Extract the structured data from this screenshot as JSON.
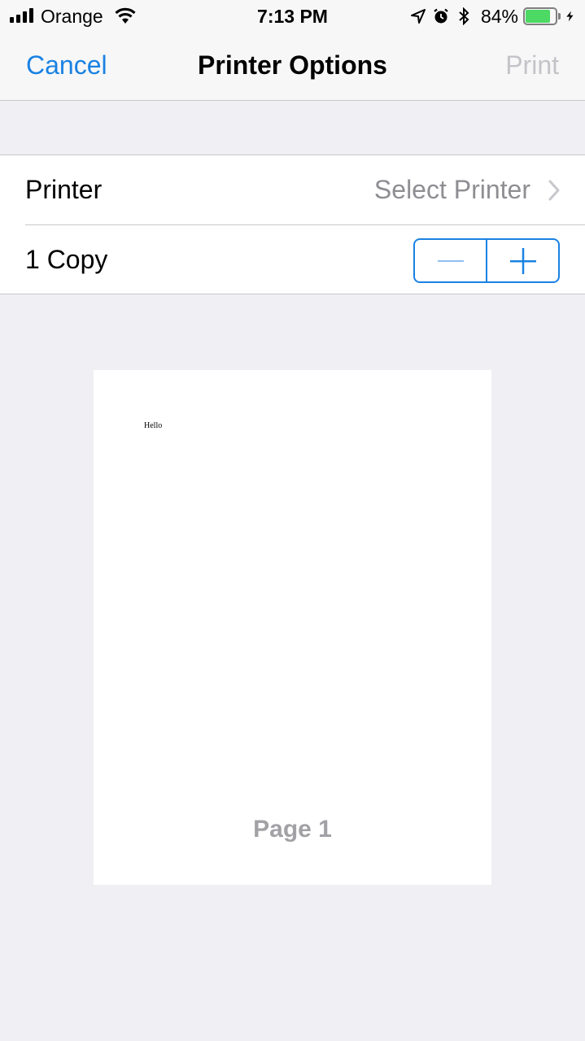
{
  "status_bar": {
    "carrier": "Orange",
    "time": "7:13 PM",
    "battery_percent": "84%",
    "battery_level": 0.84,
    "icons": [
      "signal-icon",
      "wifi-icon",
      "location-arrow-icon",
      "alarm-icon",
      "bluetooth-icon",
      "battery-icon",
      "charging-bolt-icon"
    ]
  },
  "nav": {
    "cancel_label": "Cancel",
    "title": "Printer Options",
    "print_label": "Print"
  },
  "options": {
    "printer_label": "Printer",
    "printer_value": "Select Printer",
    "copies_label": "1 Copy",
    "copies_count": 1
  },
  "preview": {
    "body_text": "Hello",
    "page_label": "Page 1"
  },
  "colors": {
    "accent": "#1a82e2",
    "background": "#efeff4",
    "disabled": "#c4c4c8",
    "secondary_text": "#8e8e93",
    "battery_fill": "#4cd964"
  }
}
